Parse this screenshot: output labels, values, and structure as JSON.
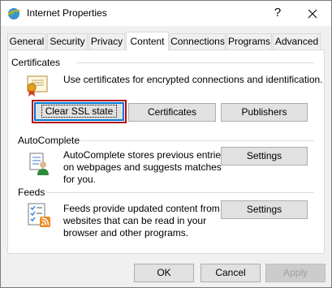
{
  "window": {
    "title": "Internet Properties",
    "help_label": "?"
  },
  "tabs": [
    {
      "label": "General"
    },
    {
      "label": "Security"
    },
    {
      "label": "Privacy"
    },
    {
      "label": "Content",
      "active": true
    },
    {
      "label": "Connections"
    },
    {
      "label": "Programs"
    },
    {
      "label": "Advanced"
    }
  ],
  "certificates": {
    "heading": "Certificates",
    "description": "Use certificates for encrypted connections and identification.",
    "clear_ssl_label": "Clear SSL state",
    "certificates_label": "Certificates",
    "publishers_label": "Publishers"
  },
  "autocomplete": {
    "heading": "AutoComplete",
    "description_lines": [
      "AutoComplete stores previous entries",
      "on webpages and suggests matches",
      "for you."
    ],
    "settings_label": "Settings"
  },
  "feeds": {
    "heading": "Feeds",
    "description_lines": [
      "Feeds provide updated content from",
      "websites that can be read in your",
      "browser and other programs."
    ],
    "settings_label": "Settings"
  },
  "footer": {
    "ok_label": "OK",
    "cancel_label": "Cancel",
    "apply_label": "Apply"
  },
  "colors": {
    "focus_outline": "#b4070d",
    "focus_border": "#0078d7",
    "dialog_bg": "#f0f0f0"
  },
  "icons": [
    "internet-options-icon",
    "close-icon",
    "certificate-icon",
    "autocomplete-icon",
    "feeds-icon"
  ]
}
